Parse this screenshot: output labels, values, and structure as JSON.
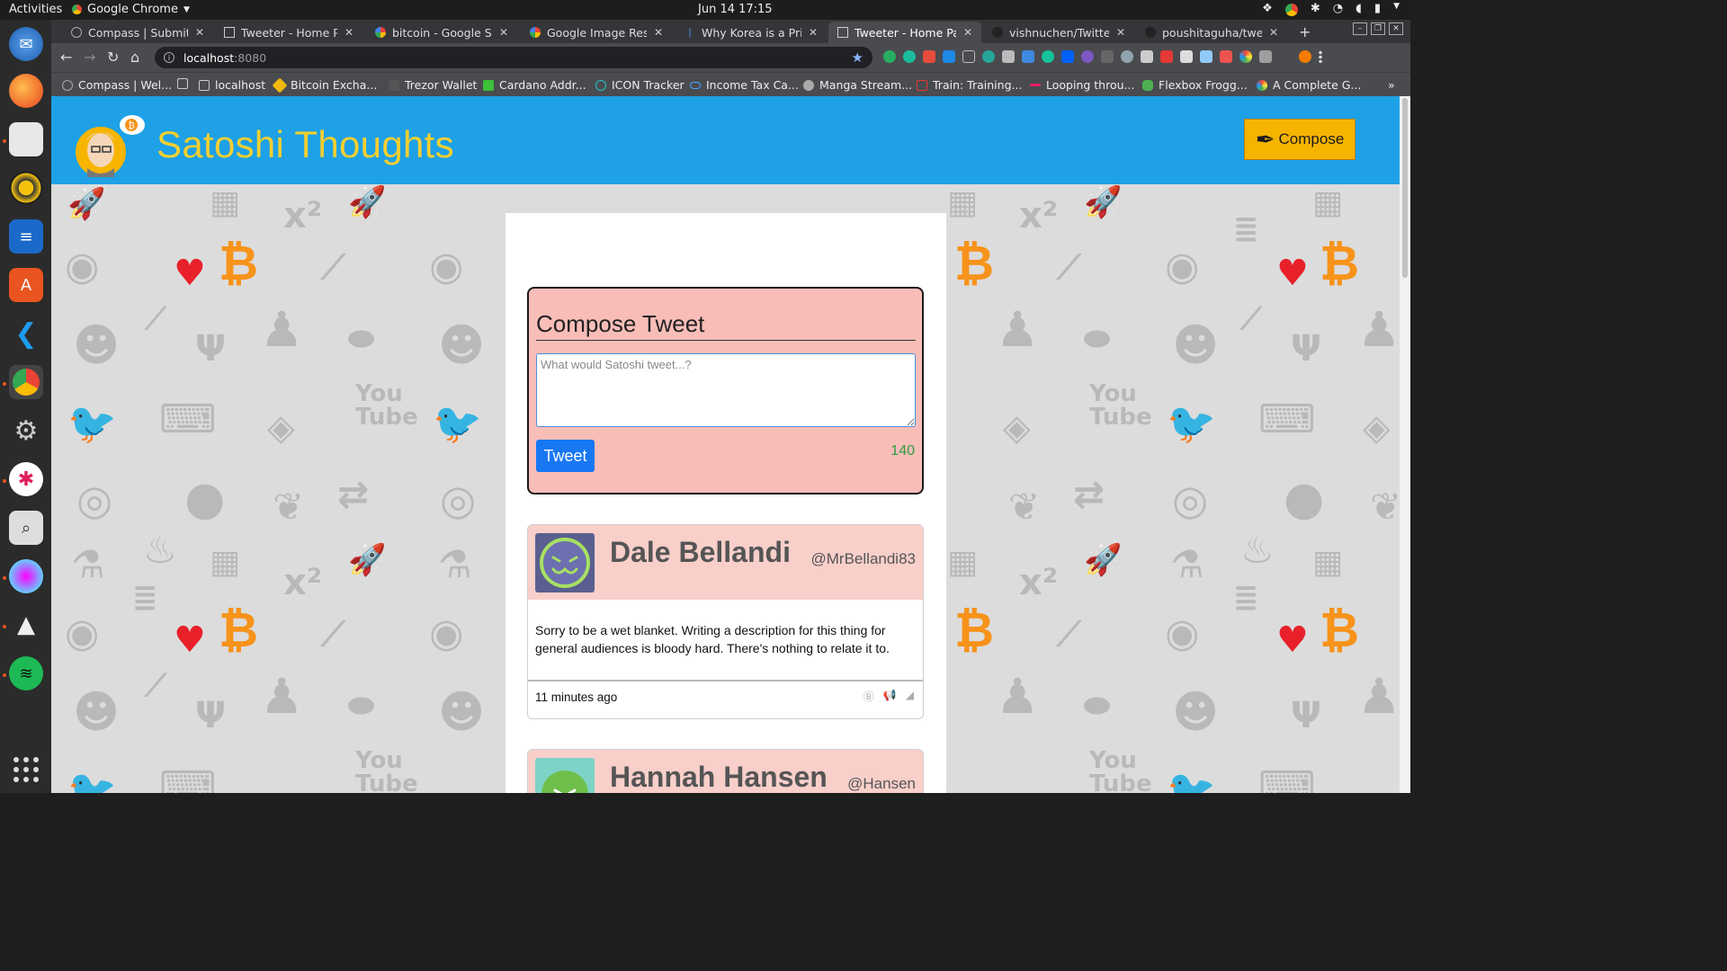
{
  "system": {
    "activities": "Activities",
    "app_name": "Google Chrome",
    "clock": "Jun 14  17:15"
  },
  "browser": {
    "tabs": [
      {
        "title": "Compass | Submit Pro",
        "active": false
      },
      {
        "title": "Tweeter - Home Page",
        "active": false
      },
      {
        "title": "bitcoin - Google Searc",
        "active": false
      },
      {
        "title": "Google Image Result",
        "active": false
      },
      {
        "title": "Why Korea is a Prime",
        "active": false
      },
      {
        "title": "Tweeter - Home Page",
        "active": true
      },
      {
        "title": "vishnuchen/Twitter-t",
        "active": false
      },
      {
        "title": "poushitaguha/tweet",
        "active": false
      }
    ],
    "url_host": "localhost",
    "url_port": ":8080",
    "bookmarks": [
      "Compass | Wel...",
      "",
      "localhost",
      "Bitcoin Excha...",
      "Trezor Wallet",
      "Cardano Addr...",
      "ICON Tracker",
      "Income Tax Ca...",
      "Manga Stream...",
      "Train: Training...",
      "Looping throu...",
      "Flexbox Frogg...",
      "A Complete G..."
    ]
  },
  "header": {
    "title": "Satoshi Thoughts",
    "compose_label": "Compose"
  },
  "compose": {
    "title": "Compose Tweet",
    "placeholder": "What would Satoshi tweet...?",
    "button": "Tweet",
    "counter": "140"
  },
  "tweets": [
    {
      "name": "Dale Bellandi",
      "handle": "@MrBellandi83",
      "text": "Sorry to be a wet blanket. Writing a description for this thing for general audiences is bloody hard. There's nothing to relate it to.",
      "time": "11 minutes ago"
    },
    {
      "name": "Hannah Hansen",
      "handle": "@Hansen"
    }
  ],
  "colors": {
    "header_bg": "#1ea1e6",
    "title": "#f3cf31",
    "compose_btn": "#f5b400",
    "compose_box": "#f9bdb8",
    "tweet_btn": "#1877f2",
    "counter": "#2a9d3c"
  }
}
